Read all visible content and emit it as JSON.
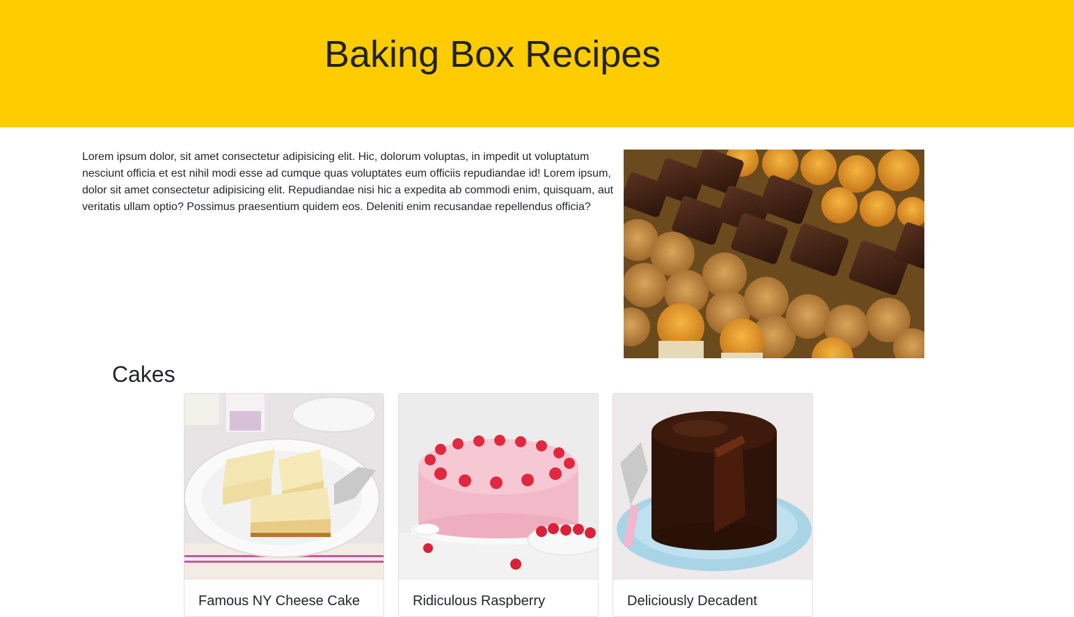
{
  "header": {
    "title": "Baking Box Recipes",
    "background_color": "#ffcc00"
  },
  "intro": {
    "text": "Lorem ipsum dolor, sit amet consectetur adipisicing elit. Hic, dolorum voluptas, in impedit ut voluptatum nesciunt officia et est nihil modi esse ad cumque quas voluptates eum officiis repudiandae id! Lorem ipsum, dolor sit amet consectetur adipisicing elit. Repudiandae nisi hic a expedita ab commodi enim, quisquam, aut veritatis ullam optio? Possimus praesentium quidem eos. Deleniti enim recusandae repellendus officia?",
    "image": "baked-goods-assortment-photo"
  },
  "cakes_section": {
    "title": "Cakes",
    "cards": [
      {
        "title": "Famous NY Cheese Cake",
        "image": "cheesecake-photo"
      },
      {
        "title": "Ridiculous Raspberry",
        "image": "raspberry-cake-photo"
      },
      {
        "title": "Deliciously Decadent",
        "image": "chocolate-cake-photo"
      }
    ]
  }
}
